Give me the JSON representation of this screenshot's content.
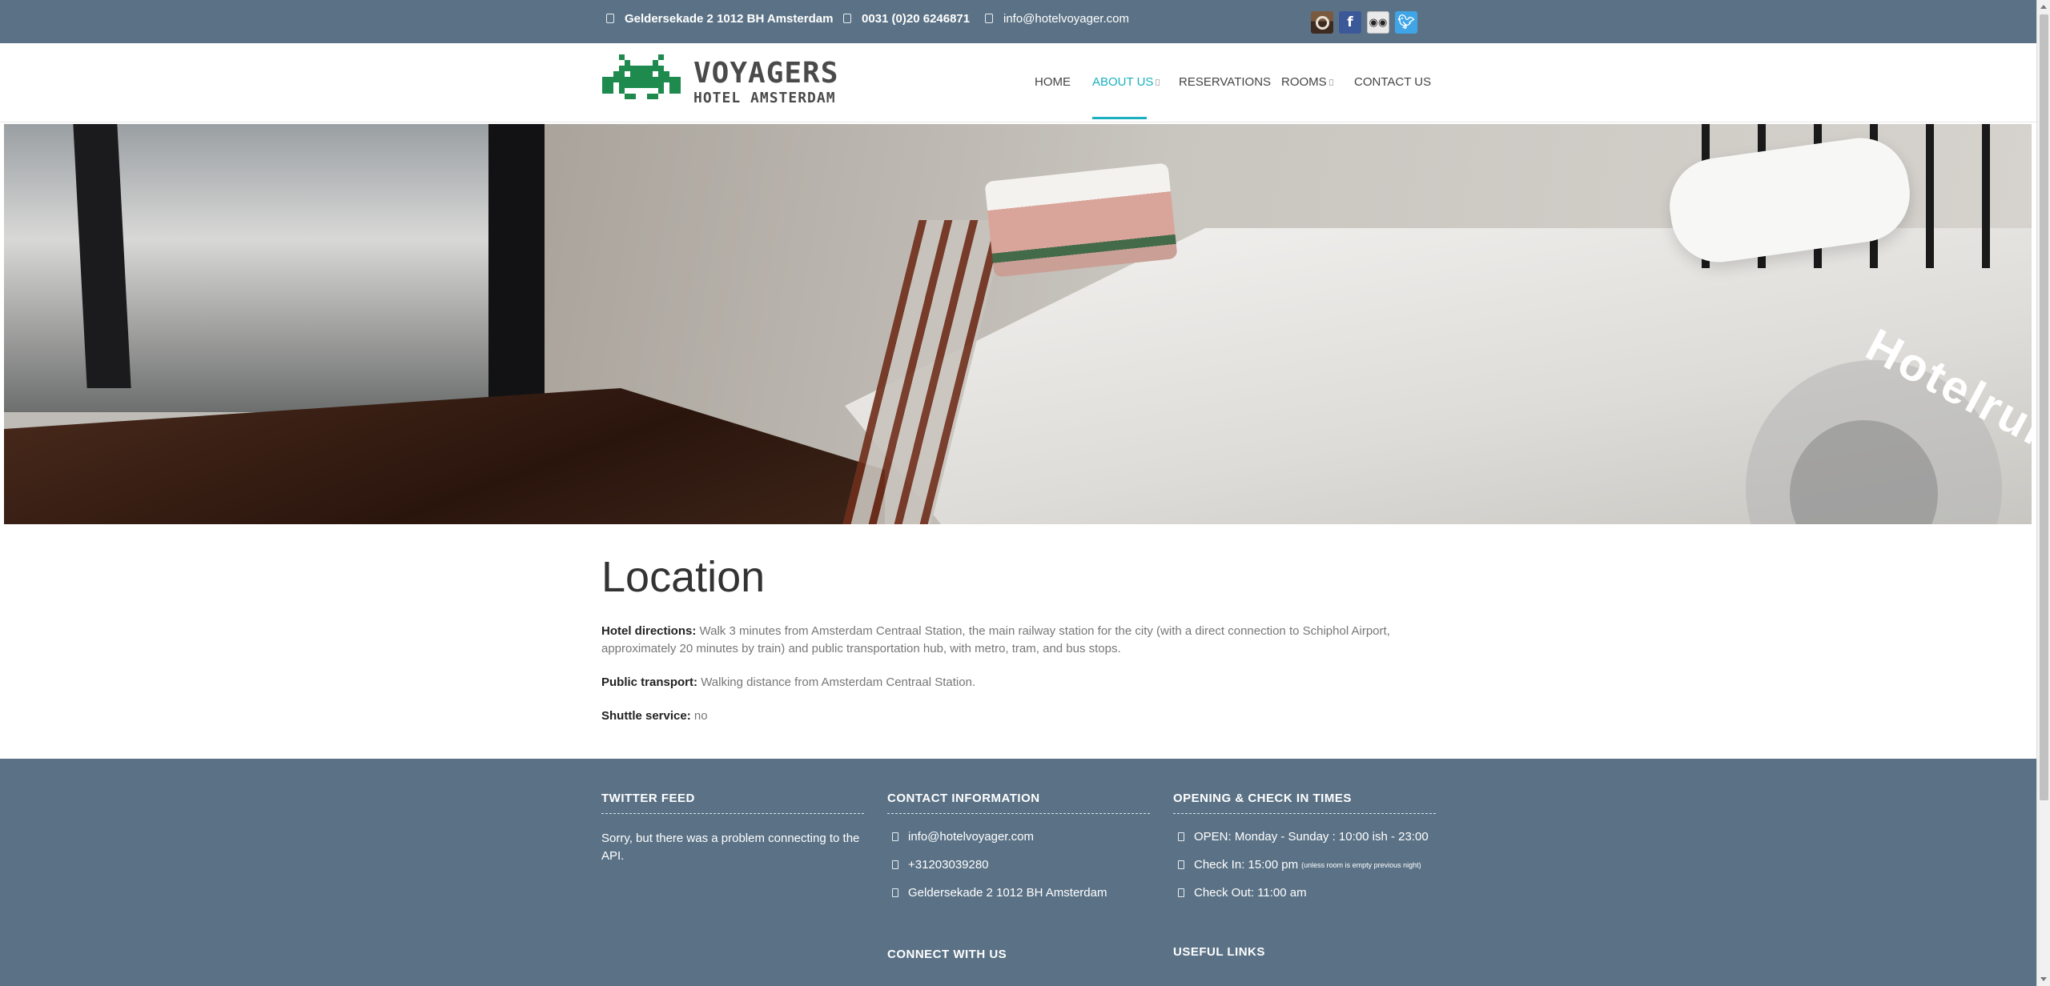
{
  "topbar": {
    "address": "Geldersekade 2 1012 BH Amsterdam",
    "phone": "0031 (0)20 6246871",
    "email": "info@hotelvoyager.com",
    "social": [
      "instagram-icon",
      "facebook-icon",
      "tripadvisor-icon",
      "twitter-icon"
    ]
  },
  "logo": {
    "line1": "VOYAGERS",
    "line2": "HOTEL AMSTERDAM"
  },
  "nav": {
    "items": [
      {
        "label": "HOME"
      },
      {
        "label": "ABOUT US",
        "active": true
      },
      {
        "label": "RESERVATIONS"
      },
      {
        "label": "ROOMS"
      },
      {
        "label": "CONTACT US"
      }
    ]
  },
  "hero": {
    "watermark": "Hotelrun"
  },
  "content": {
    "title": "Location",
    "directions_label": "Hotel directions:",
    "directions_text": "Walk 3 minutes from Amsterdam Centraal Station, the main railway station for the city (with a direct connection to Schiphol Airport, approximately 20 minutes by train) and public transportation hub, with metro, tram, and bus stops.",
    "transport_label": "Public transport:",
    "transport_text": "Walking distance from Amsterdam Centraal Station.",
    "shuttle_label": "Shuttle service:",
    "shuttle_text": "no"
  },
  "footer": {
    "twitter_title": "TWITTER FEED",
    "twitter_text": "Sorry, but there was a problem connecting to the API.",
    "contact_title": "CONTACT INFORMATION",
    "contact_email": "info@hotelvoyager.com",
    "contact_phone": "+31203039280",
    "contact_address": "Geldersekade 2 1012 BH Amsterdam",
    "connect_title": "CONNECT WITH US",
    "hours_title": "OPENING & CHECK IN TIMES",
    "hours_open": "OPEN: Monday - Sunday : 10:00 ish - 23:00",
    "hours_checkin": "Check In: 15:00 pm",
    "hours_checkin_note": "(unless room is empty previous night)",
    "hours_checkout": "Check Out: 11:00 am",
    "links_title": "USEFUL LINKS"
  },
  "colors": {
    "topbar": "#5b7286",
    "accent": "#1ab0c0",
    "logo_green": "#1e8a4e"
  }
}
